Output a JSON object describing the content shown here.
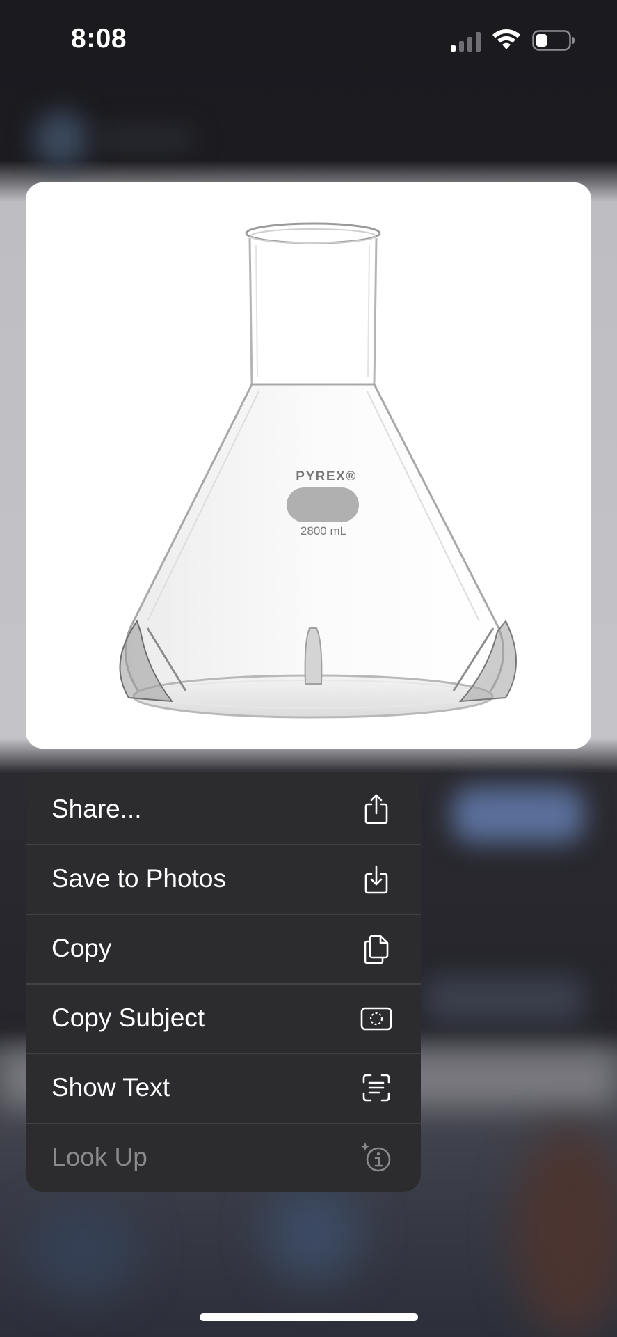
{
  "status_bar": {
    "time": "8:08"
  },
  "preview": {
    "brand_text": "PYREX®",
    "volume_text": "2800 mL"
  },
  "context_menu": {
    "items": [
      {
        "label": "Share...",
        "icon": "share-icon",
        "enabled": true
      },
      {
        "label": "Save to Photos",
        "icon": "save-to-photos-icon",
        "enabled": true
      },
      {
        "label": "Copy",
        "icon": "copy-icon",
        "enabled": true
      },
      {
        "label": "Copy Subject",
        "icon": "copy-subject-icon",
        "enabled": true
      },
      {
        "label": "Show Text",
        "icon": "show-text-icon",
        "enabled": true
      },
      {
        "label": "Look Up",
        "icon": "look-up-icon",
        "enabled": false
      }
    ]
  },
  "colors": {
    "menu_background": "#2c2c2f",
    "menu_text": "#ffffff",
    "menu_text_disabled": "#8a8a8e",
    "divider": "#424246"
  }
}
